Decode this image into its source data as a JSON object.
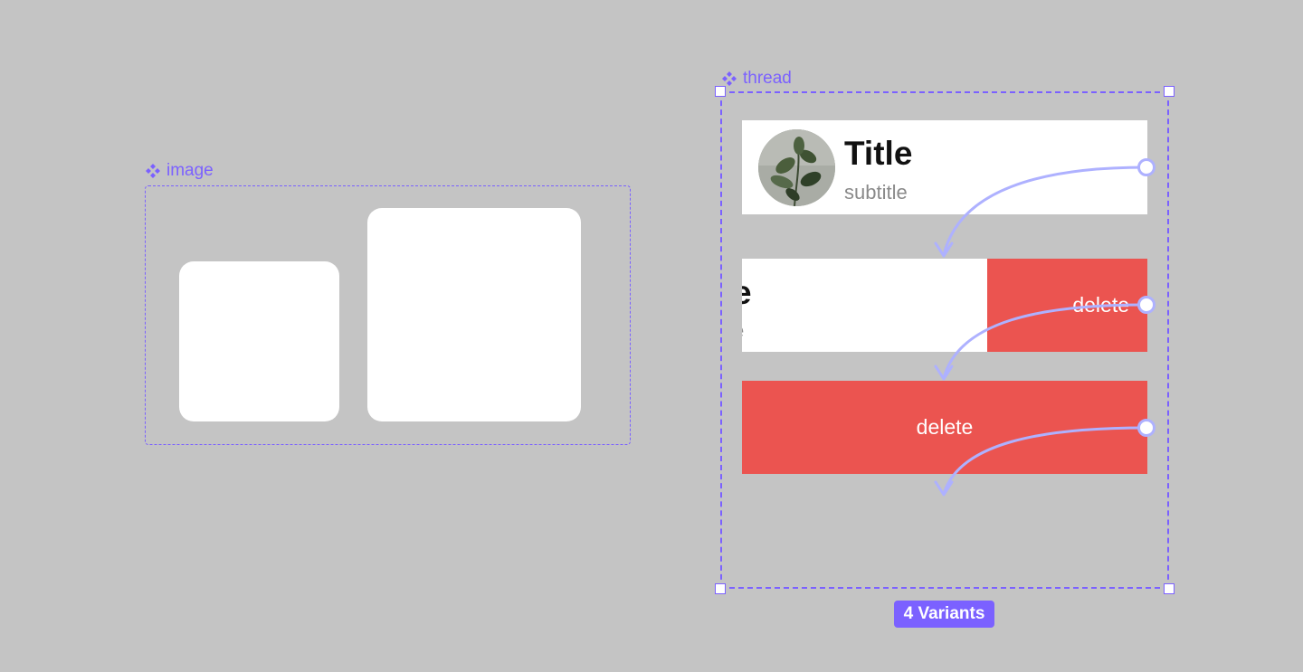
{
  "canvas": {
    "background": "#c4c4c4",
    "accent": "#7b61ff",
    "delete_color": "#eb5450",
    "arrow_color": "#aeb1ff"
  },
  "image_component": {
    "label": "image",
    "icon": "component-diamond-icon"
  },
  "thread_component": {
    "label": "thread",
    "icon": "component-diamond-icon",
    "variant_count_label": "4 Variants",
    "variants": [
      {
        "title": "Title",
        "subtitle": "subtitle",
        "avatar": "plant-photo"
      },
      {
        "title_fragment": "e",
        "subtitle_fragment": "e",
        "action": "delete"
      },
      {
        "action": "delete"
      }
    ]
  }
}
